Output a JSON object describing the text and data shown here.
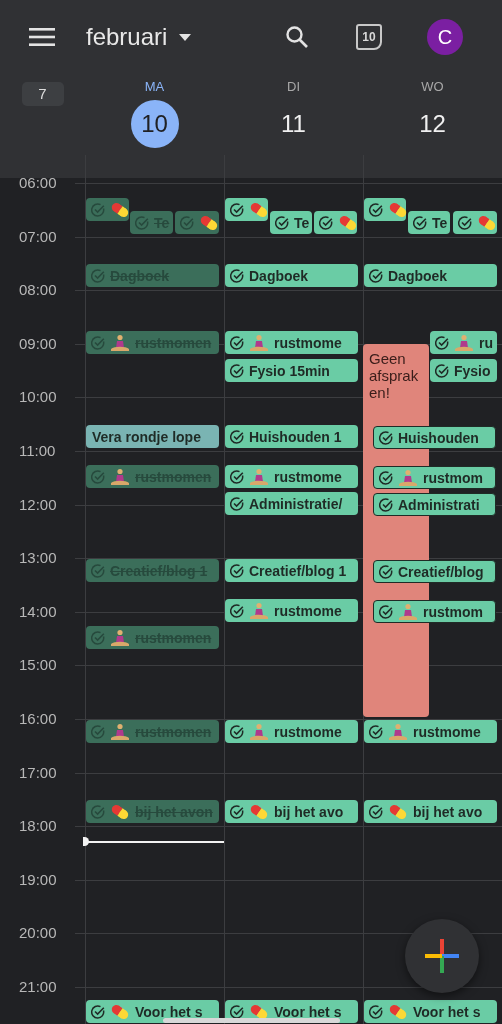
{
  "top_bar": {
    "month": "februari",
    "today_icon": "10",
    "avatar": "C"
  },
  "week_number": "7",
  "days": [
    {
      "weekday": "MA",
      "date": "10",
      "selected": true,
      "events": [
        {
          "kind": "pill_task",
          "done": true
        },
        {
          "kind": "task",
          "label": "Te",
          "done": true
        },
        {
          "kind": "pill_task",
          "done": true
        },
        {
          "kind": "task",
          "label": "Dagboek",
          "done": true
        },
        {
          "kind": "yoga_task",
          "label": "rustmomen",
          "done": true
        },
        {
          "kind": "event",
          "label": "Vera rondje lope",
          "color": "#7ab4b3"
        },
        {
          "kind": "yoga_task",
          "label": "rustmomen",
          "done": true
        },
        {
          "kind": "task",
          "label": "Creatief/blog 1",
          "done": true
        },
        {
          "kind": "yoga_task",
          "label": "rustmomen",
          "done": true
        },
        {
          "kind": "yoga_task",
          "label": "rustmomen",
          "done": true
        },
        {
          "kind": "pill_task",
          "label": "bij het avon",
          "done": true
        },
        {
          "kind": "pill_task",
          "label": "Voor het s",
          "done": false
        }
      ]
    },
    {
      "weekday": "DI",
      "date": "11",
      "selected": false,
      "events": [
        {
          "kind": "pill_task",
          "done": false
        },
        {
          "kind": "task",
          "label": "Te",
          "done": false
        },
        {
          "kind": "pill_task",
          "done": false
        },
        {
          "kind": "task",
          "label": "Dagboek",
          "done": false
        },
        {
          "kind": "yoga_task",
          "label": "rustmome",
          "done": false
        },
        {
          "kind": "task",
          "label": "Fysio 15min",
          "done": false
        },
        {
          "kind": "task",
          "label": "Huishouden 1",
          "done": false
        },
        {
          "kind": "yoga_task",
          "label": "rustmome",
          "done": false
        },
        {
          "kind": "task",
          "label": "Administratie/",
          "done": false
        },
        {
          "kind": "task",
          "label": "Creatief/blog 1",
          "done": false
        },
        {
          "kind": "yoga_task",
          "label": "rustmome",
          "done": false
        },
        {
          "kind": "yoga_task",
          "label": "rustmome",
          "done": false
        },
        {
          "kind": "pill_task",
          "label": "bij het avo",
          "done": false
        },
        {
          "kind": "pill_task",
          "label": "Voor het s",
          "done": false
        }
      ]
    },
    {
      "weekday": "WO",
      "date": "12",
      "selected": false,
      "events": [
        {
          "kind": "pill_task",
          "done": false
        },
        {
          "kind": "task",
          "label": "Te",
          "done": false
        },
        {
          "kind": "pill_task",
          "done": false
        },
        {
          "kind": "task",
          "label": "Dagboek",
          "done": false
        },
        {
          "kind": "note",
          "label": "Geen afspraken!",
          "color": "#e0857b"
        },
        {
          "kind": "yoga_task",
          "label": "ru",
          "done": false
        },
        {
          "kind": "task",
          "label": "Fysio",
          "done": false
        },
        {
          "kind": "task",
          "label": "Huishouden",
          "done": false
        },
        {
          "kind": "yoga_task",
          "label": "rustmom",
          "done": false
        },
        {
          "kind": "task",
          "label": "Administrati",
          "done": false
        },
        {
          "kind": "task",
          "label": "Creatief/blog",
          "done": false
        },
        {
          "kind": "yoga_task",
          "label": "rustmom",
          "done": false
        },
        {
          "kind": "yoga_task",
          "label": "rustmome",
          "done": false
        },
        {
          "kind": "pill_task",
          "label": "bij het avo",
          "done": false
        },
        {
          "kind": "pill_task",
          "label": "Voor het s",
          "done": false
        }
      ]
    }
  ],
  "hours": [
    "06:00",
    "07:00",
    "08:00",
    "09:00",
    "10:00",
    "11:00",
    "12:00",
    "13:00",
    "14:00",
    "15:00",
    "16:00",
    "17:00",
    "18:00",
    "19:00",
    "20:00",
    "21:00"
  ]
}
